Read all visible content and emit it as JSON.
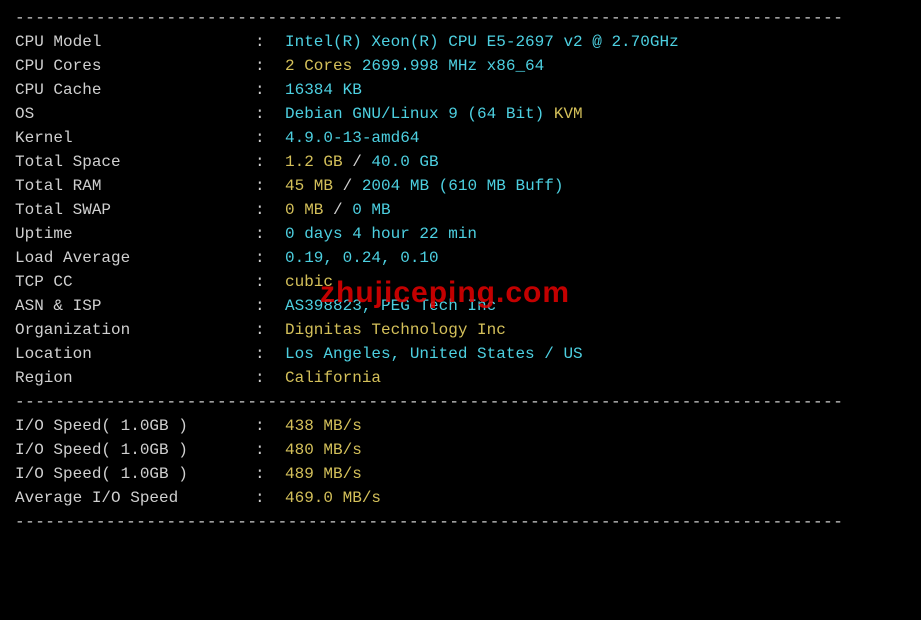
{
  "divider": "----------------------------------------------------------------------------------",
  "sys": {
    "cpu_model": {
      "label": "CPU Model",
      "value": "Intel(R) Xeon(R) CPU E5-2697 v2 @ 2.70GHz"
    },
    "cpu_cores": {
      "label": "CPU Cores",
      "cores": "2 Cores",
      "freq": " 2699.998 MHz x86_64"
    },
    "cpu_cache": {
      "label": "CPU Cache",
      "value": "16384 KB"
    },
    "os": {
      "label": "OS",
      "name": "Debian GNU/Linux 9 (64 Bit)",
      "virt": " KVM"
    },
    "kernel": {
      "label": "Kernel",
      "value": "4.9.0-13-amd64"
    },
    "total_space": {
      "label": "Total Space",
      "used": "1.2 GB",
      "sep": " / ",
      "total": "40.0 GB"
    },
    "total_ram": {
      "label": "Total RAM",
      "used": "45 MB",
      "sep": " / ",
      "total": "2004 MB",
      "buff": " (610 MB Buff)"
    },
    "total_swap": {
      "label": "Total SWAP",
      "used": "0 MB",
      "sep": " / ",
      "total": "0 MB"
    },
    "uptime": {
      "label": "Uptime",
      "value": "0 days 4 hour 22 min"
    },
    "load_avg": {
      "label": "Load Average",
      "value": "0.19, 0.24, 0.10"
    },
    "tcp_cc": {
      "label": "TCP CC",
      "value": "cubic"
    },
    "asn_isp": {
      "label": "ASN & ISP",
      "value": "AS398823, PEG Tech Inc"
    },
    "org": {
      "label": "Organization",
      "value": "Dignitas Technology Inc"
    },
    "location": {
      "label": "Location",
      "value": "Los Angeles, United States / US"
    },
    "region": {
      "label": "Region",
      "value": "California"
    }
  },
  "io": {
    "test1": {
      "label": "I/O Speed( 1.0GB )",
      "value": "438 MB/s"
    },
    "test2": {
      "label": "I/O Speed( 1.0GB )",
      "value": "480 MB/s"
    },
    "test3": {
      "label": "I/O Speed( 1.0GB )",
      "value": "489 MB/s"
    },
    "avg": {
      "label": "Average I/O Speed",
      "value": "469.0 MB/s"
    }
  },
  "watermark": "zhujiceping.com"
}
